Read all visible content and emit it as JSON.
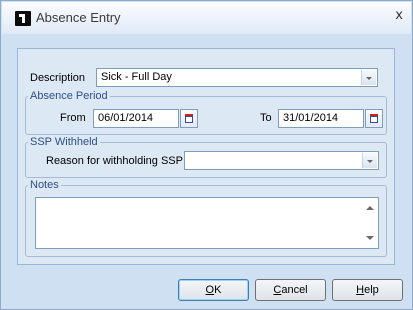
{
  "window": {
    "title": "Absence Entry",
    "close_glyph": "x",
    "app_icon": "application-icon"
  },
  "form": {
    "description_label": "Description",
    "description_value": "Sick - Full Day",
    "absence_period": {
      "legend": "Absence Period",
      "from_label": "From",
      "from_value": "06/01/2014",
      "to_label": "To",
      "to_value": "31/01/2014"
    },
    "ssp": {
      "legend": "SSP Withheld",
      "reason_label": "Reason for withholding SSP",
      "reason_value": ""
    },
    "notes": {
      "legend": "Notes",
      "value": ""
    }
  },
  "buttons": {
    "ok": {
      "mnemonic": "O",
      "rest": "K"
    },
    "cancel": {
      "mnemonic": "C",
      "rest": "ancel"
    },
    "help": {
      "mnemonic": "H",
      "rest": "elp"
    }
  },
  "colors": {
    "window_bg": "#cfe0f3",
    "panel_bg": "#dde8f5",
    "group_legend": "#2e4f88",
    "field_border": "#7f9db9"
  }
}
